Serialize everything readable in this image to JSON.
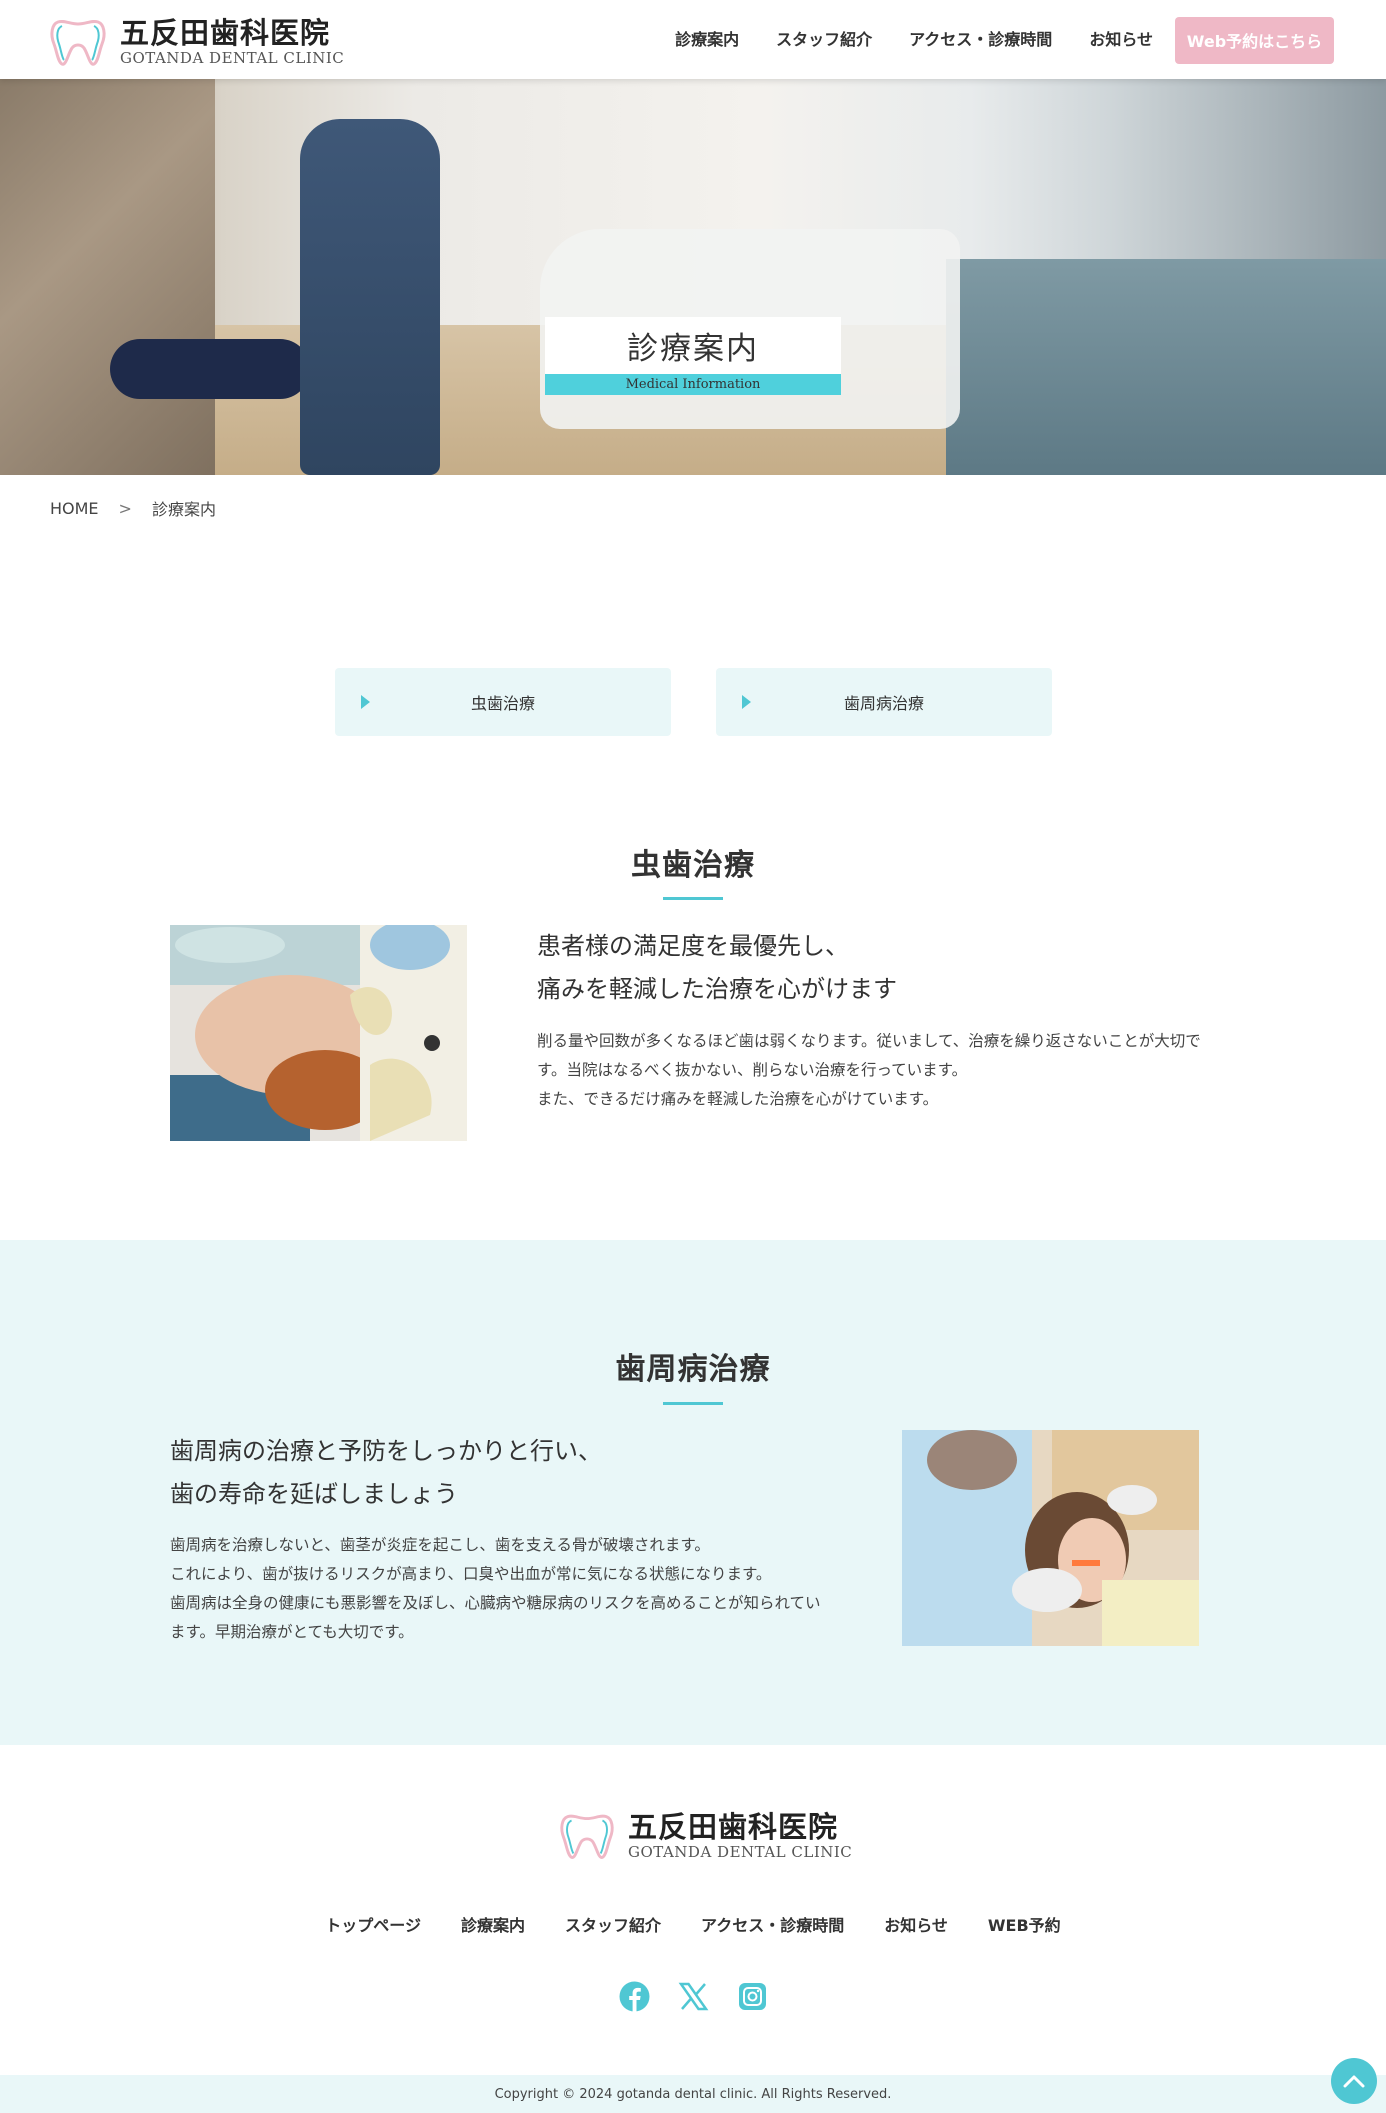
{
  "header": {
    "logo_ja": "五反田歯科医院",
    "logo_en": "GOTANDA DENTAL CLINIC",
    "nav": [
      "診療案内",
      "スタッフ紹介",
      "アクセス・診療時間",
      "お知らせ"
    ],
    "reserve": "Web予約はこちら"
  },
  "hero": {
    "title": "診療案内",
    "subtitle": "Medical Information"
  },
  "breadcrumb": {
    "home": "HOME",
    "sep": ">",
    "current": "診療案内"
  },
  "anchors": [
    "虫歯治療",
    "歯周病治療"
  ],
  "caries": {
    "title": "虫歯治療",
    "lead1": "患者様の満足度を最優先し、",
    "lead2": "痛みを軽減した治療を心がけます",
    "body1": "削る量や回数が多くなるほど歯は弱くなります。従いまして、治療を繰り返さないことが大切で",
    "body2": "す。当院はなるべく抜かない、削らない治療を行っています。",
    "body3": "また、できるだけ痛みを軽減した治療を心がけています。"
  },
  "perio": {
    "title": "歯周病治療",
    "lead1": "歯周病の治療と予防をしっかりと行い、",
    "lead2": "歯の寿命を延ばしましょう",
    "body1": "歯周病を治療しないと、歯茎が炎症を起こし、歯を支える骨が破壊されます。",
    "body2": "これにより、歯が抜けるリスクが高まり、口臭や出血が常に気になる状態になります。",
    "body3": "歯周病は全身の健康にも悪影響を及ぼし、心臓病や糖尿病のリスクを高めることが知られてい",
    "body4": "ます。早期治療がとても大切です。"
  },
  "footer": {
    "logo_ja": "五反田歯科医院",
    "logo_en": "GOTANDA DENTAL CLINIC",
    "nav": [
      "トップページ",
      "診療案内",
      "スタッフ紹介",
      "アクセス・診療時間",
      "お知らせ",
      "WEB予約"
    ],
    "social": [
      "facebook-icon",
      "x-icon",
      "instagram-icon"
    ],
    "copyright": "Copyright © 2024 gotanda dental clinic. All Rights Reserved."
  },
  "colors": {
    "accent": "#4fc7d3",
    "pink": "#efb8c6",
    "pale": "#e9f7f8"
  }
}
